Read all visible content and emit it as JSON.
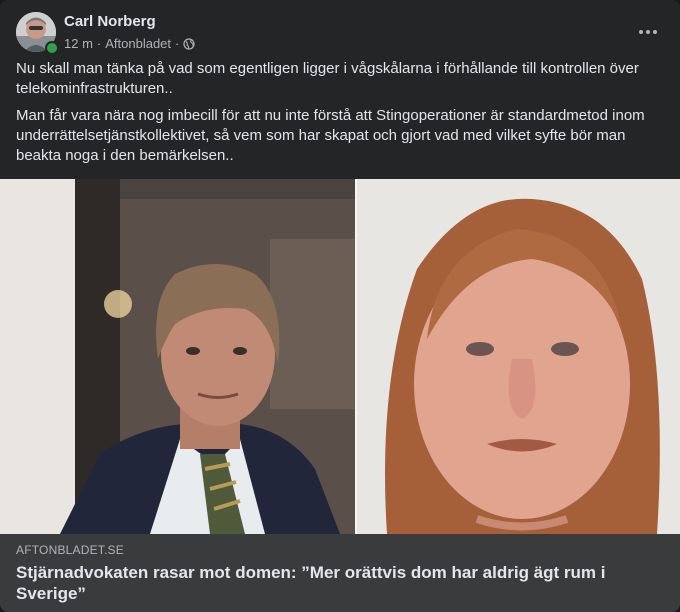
{
  "post": {
    "author": "Carl Norberg",
    "time": "12 m",
    "source": "Aftonbladet",
    "privacy_icon": "globe-icon",
    "paragraphs": [
      "Nu skall man tänka på vad som egentligen ligger i vågskålarna i förhållande till kontrollen över telekominfrastrukturen..",
      "Man får vara nära nog imbecill för att nu inte förstå att Stingoperationer är standardmetod inom underrättelsetjänstkollektivet, så vem som har skapat och gjort vad med vilket syfte bör man beakta noga i den bemärkelsen.."
    ]
  },
  "link": {
    "domain": "AFTONBLADET.SE",
    "title": "Stjärnadvokaten rasar mot domen: ”Mer orättvis dom har aldrig ägt rum i Sverige”"
  },
  "colors": {
    "card_bg": "#242526",
    "link_bg": "#3a3b3c",
    "text": "#e4e6eb",
    "secondary_text": "#b0b3b8",
    "online": "#31a24c"
  }
}
